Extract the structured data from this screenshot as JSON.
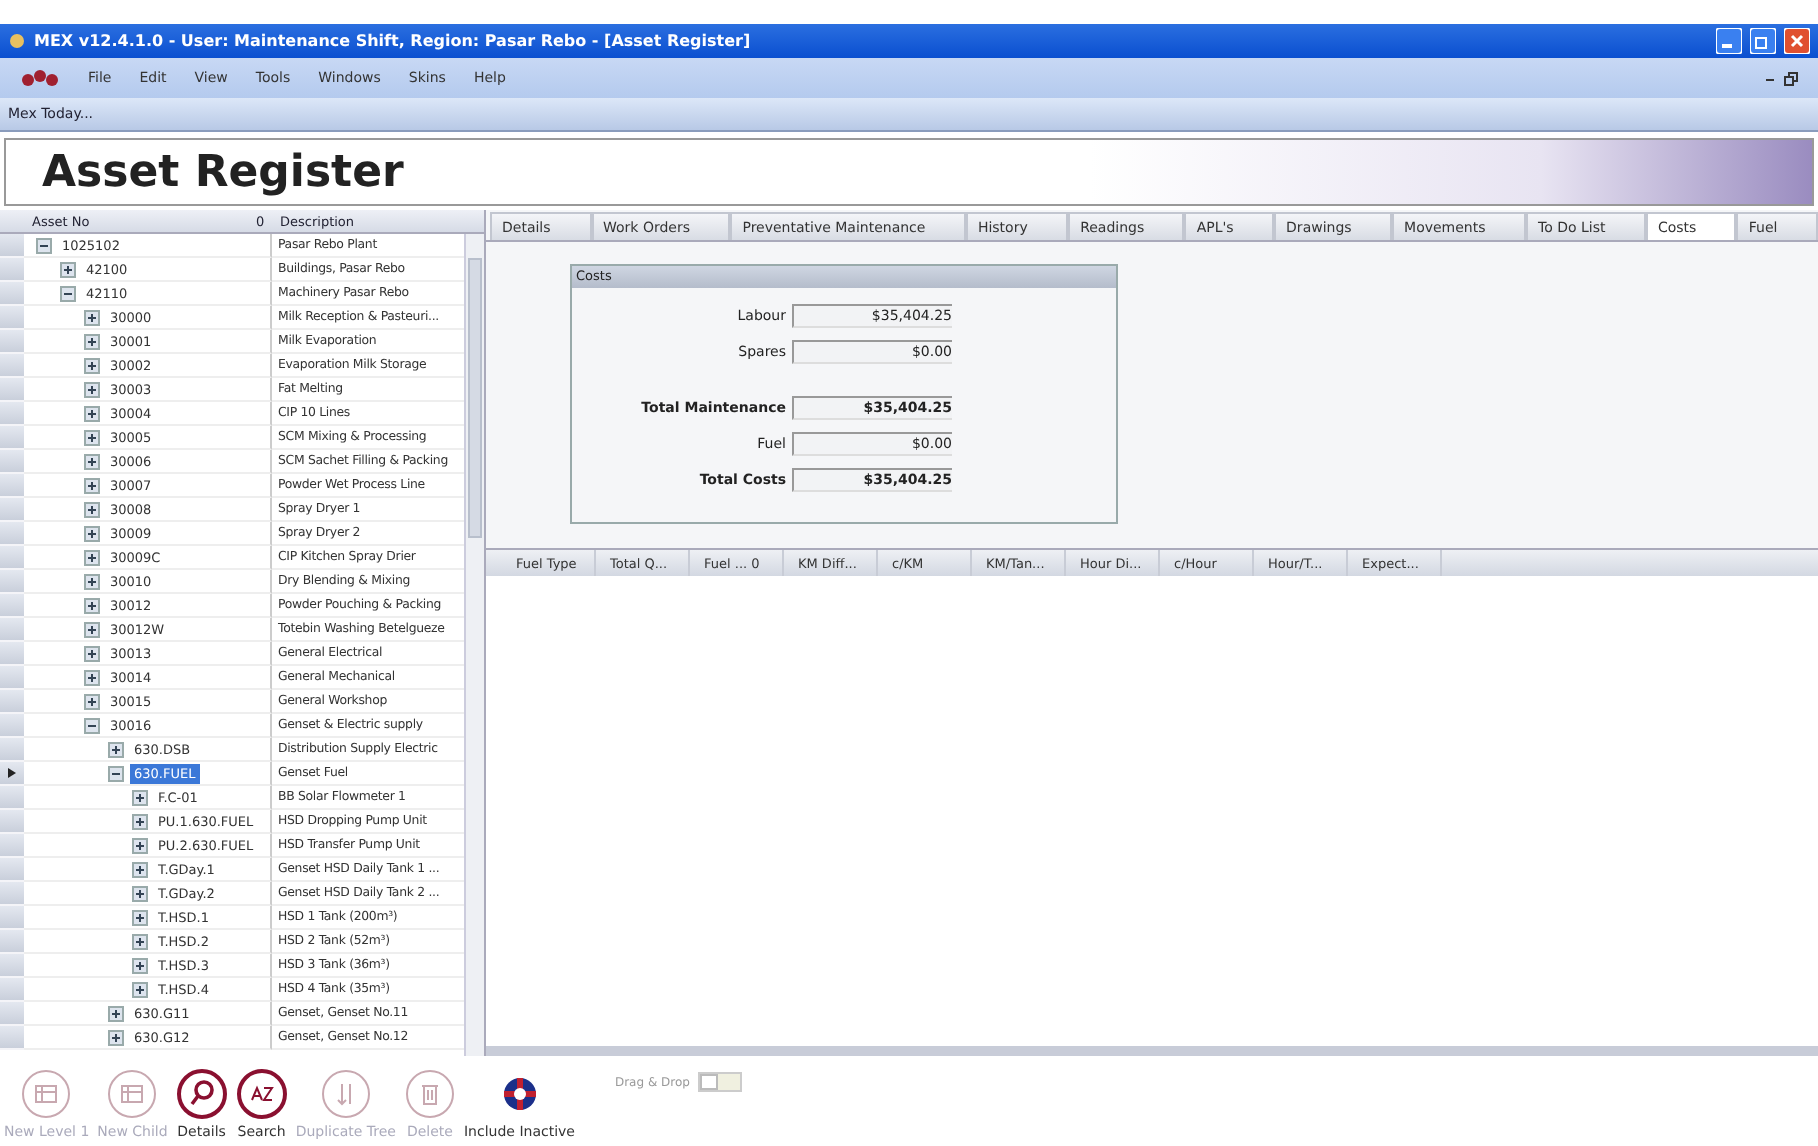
{
  "window": {
    "title": "MEX v12.4.1.0 - User: Maintenance Shift, Region: Pasar Rebo - [Asset Register]"
  },
  "menu": [
    "File",
    "Edit",
    "View",
    "Tools",
    "Windows",
    "Skins",
    "Help"
  ],
  "quick_bar": {
    "label": "Mex Today..."
  },
  "page_title": "Asset Register",
  "tree": {
    "columns": [
      "Asset No",
      "0",
      "Description"
    ],
    "items": [
      {
        "asset": "1025102",
        "description": "Pasar Rebo Plant",
        "expanded": true,
        "selected": false,
        "children": [
          {
            "asset": "42100",
            "description": "Buildings, Pasar Rebo",
            "expanded": false,
            "selected": false
          },
          {
            "asset": "42110",
            "description": "Machinery Pasar Rebo",
            "expanded": true,
            "selected": false,
            "children": [
              {
                "asset": "30000",
                "description": "Milk Reception & Pasteuri...",
                "expanded": false,
                "selected": false
              },
              {
                "asset": "30001",
                "description": "Milk Evaporation",
                "expanded": false,
                "selected": false
              },
              {
                "asset": "30002",
                "description": "Evaporation Milk Storage",
                "expanded": false,
                "selected": false
              },
              {
                "asset": "30003",
                "description": "Fat Melting",
                "expanded": false,
                "selected": false
              },
              {
                "asset": "30004",
                "description": "CIP 10 Lines",
                "expanded": false,
                "selected": false
              },
              {
                "asset": "30005",
                "description": "SCM Mixing & Processing",
                "expanded": false,
                "selected": false
              },
              {
                "asset": "30006",
                "description": "SCM Sachet Filling & Packing",
                "expanded": false,
                "selected": false
              },
              {
                "asset": "30007",
                "description": "Powder Wet Process Line",
                "expanded": false,
                "selected": false
              },
              {
                "asset": "30008",
                "description": "Spray Dryer 1",
                "expanded": false,
                "selected": false
              },
              {
                "asset": "30009",
                "description": "Spray Dryer 2",
                "expanded": false,
                "selected": false
              },
              {
                "asset": "30009C",
                "description": "CIP Kitchen Spray Drier",
                "expanded": false,
                "selected": false
              },
              {
                "asset": "30010",
                "description": "Dry Blending & Mixing",
                "expanded": false,
                "selected": false
              },
              {
                "asset": "30012",
                "description": "Powder Pouching & Packing",
                "expanded": false,
                "selected": false
              },
              {
                "asset": "30012W",
                "description": "Totebin Washing Betelgueze",
                "expanded": false,
                "selected": false
              },
              {
                "asset": "30013",
                "description": "General Electrical",
                "expanded": false,
                "selected": false
              },
              {
                "asset": "30014",
                "description": "General Mechanical",
                "expanded": false,
                "selected": false
              },
              {
                "asset": "30015",
                "description": "General Workshop",
                "expanded": false,
                "selected": false
              },
              {
                "asset": "30016",
                "description": "Genset & Electric supply",
                "expanded": true,
                "selected": false,
                "children": [
                  {
                    "asset": "630.DSB",
                    "description": "Distribution Supply Electric",
                    "expanded": false,
                    "selected": false
                  },
                  {
                    "asset": "630.FUEL",
                    "description": "Genset Fuel",
                    "expanded": true,
                    "selected": true,
                    "children": [
                      {
                        "asset": "F.C-01",
                        "description": "BB Solar Flowmeter 1",
                        "expanded": false,
                        "selected": false
                      },
                      {
                        "asset": "PU.1.630.FUEL",
                        "description": "HSD Dropping Pump Unit",
                        "expanded": false,
                        "selected": false
                      },
                      {
                        "asset": "PU.2.630.FUEL",
                        "description": "HSD Transfer Pump Unit",
                        "expanded": false,
                        "selected": false
                      },
                      {
                        "asset": "T.GDay.1",
                        "description": "Genset HSD Daily Tank 1 ...",
                        "expanded": false,
                        "selected": false
                      },
                      {
                        "asset": "T.GDay.2",
                        "description": "Genset HSD Daily Tank 2 ...",
                        "expanded": false,
                        "selected": false
                      },
                      {
                        "asset": "T.HSD.1",
                        "description": "HSD 1 Tank (200m³)",
                        "expanded": false,
                        "selected": false
                      },
                      {
                        "asset": "T.HSD.2",
                        "description": "HSD 2 Tank (52m³)",
                        "expanded": false,
                        "selected": false
                      },
                      {
                        "asset": "T.HSD.3",
                        "description": "HSD 3 Tank (36m³)",
                        "expanded": false,
                        "selected": false
                      },
                      {
                        "asset": "T.HSD.4",
                        "description": "HSD 4 Tank (35m³)",
                        "expanded": false,
                        "selected": false
                      }
                    ]
                  },
                  {
                    "asset": "630.G11",
                    "description": "Genset, Genset No.11",
                    "expanded": false,
                    "selected": false
                  },
                  {
                    "asset": "630.G12",
                    "description": "Genset, Genset No.12",
                    "expanded": false,
                    "selected": false
                  }
                ]
              }
            ]
          }
        ]
      }
    ]
  },
  "tabs": [
    {
      "label": "Details",
      "selected": false
    },
    {
      "label": "Work Orders",
      "selected": false
    },
    {
      "label": "Preventative Maintenance",
      "selected": false
    },
    {
      "label": "History",
      "selected": false
    },
    {
      "label": "Readings",
      "selected": false
    },
    {
      "label": "APL's",
      "selected": false
    },
    {
      "label": "Drawings",
      "selected": false
    },
    {
      "label": "Movements",
      "selected": false
    },
    {
      "label": "To Do List",
      "selected": false
    },
    {
      "label": "Costs",
      "selected": true
    },
    {
      "label": "Fuel",
      "selected": false
    }
  ],
  "costs": {
    "title": "Costs",
    "fields": [
      {
        "label": "Labour",
        "value": "$35,404.25",
        "kind": "line"
      },
      {
        "label": "Spares",
        "value": "$0.00",
        "kind": "line"
      },
      {
        "label": "Total Maintenance",
        "value": "$35,404.25",
        "kind": "total"
      },
      {
        "label": "Fuel",
        "value": "$0.00",
        "kind": "line"
      },
      {
        "label": "Total Costs",
        "value": "$35,404.25",
        "kind": "total"
      }
    ]
  },
  "fuel_grid": {
    "columns": [
      "Fuel Type",
      "Total Q...",
      "Fuel ... 0",
      "KM Diff...",
      "c/KM",
      "KM/Tan...",
      "Hour Di...",
      "c/Hour",
      "Hour/T...",
      "Expect..."
    ]
  },
  "toolbar": [
    {
      "label": "New Level 1",
      "kind": "grid",
      "disabled": true
    },
    {
      "label": "New Child",
      "kind": "grid",
      "disabled": true
    },
    {
      "label": "Details",
      "kind": "search",
      "disabled": false
    },
    {
      "label": "Search",
      "kind": "az",
      "disabled": false
    },
    {
      "label": "Duplicate Tree",
      "kind": "sort",
      "disabled": true
    },
    {
      "label": "Delete",
      "kind": "trash",
      "disabled": true
    },
    {
      "label": "Include Inactive",
      "kind": "lifebuoy",
      "disabled": false
    }
  ],
  "drag_drop": {
    "label": "Drag & Drop",
    "on": false
  }
}
